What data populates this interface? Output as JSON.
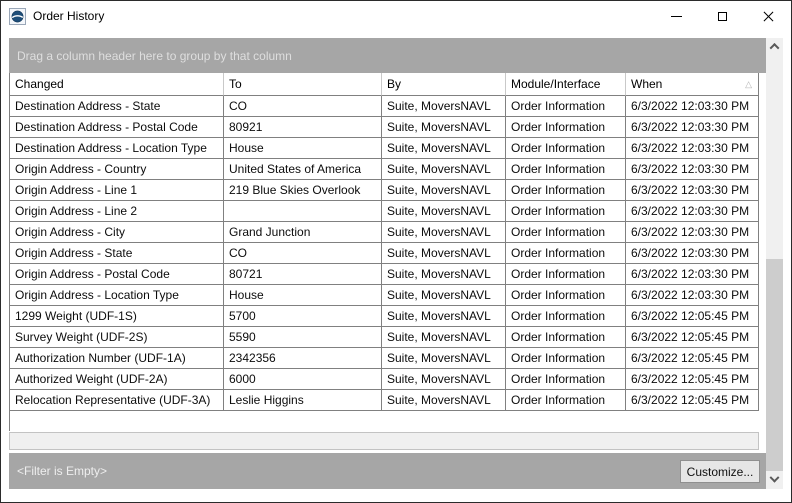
{
  "window": {
    "title": "Order History",
    "icon": "app-logo-globe",
    "controls": [
      "minimize",
      "maximize",
      "close"
    ]
  },
  "group_bar": {
    "text": "Drag a column header here to group by that column"
  },
  "table": {
    "columns": [
      {
        "key": "changed",
        "label": "Changed"
      },
      {
        "key": "to",
        "label": "To"
      },
      {
        "key": "by",
        "label": "By"
      },
      {
        "key": "module",
        "label": "Module/Interface"
      },
      {
        "key": "when",
        "label": "When"
      }
    ],
    "sort": {
      "column": "When",
      "direction": "ascending",
      "glyph": "△"
    },
    "rows": [
      {
        "changed": "Destination Address - State",
        "to": "CO",
        "by": "Suite, MoversNAVL",
        "module": "Order Information",
        "when": "6/3/2022 12:03:30 PM"
      },
      {
        "changed": "Destination Address - Postal Code",
        "to": "80921",
        "by": "Suite, MoversNAVL",
        "module": "Order Information",
        "when": "6/3/2022 12:03:30 PM"
      },
      {
        "changed": "Destination Address - Location Type",
        "to": "House",
        "by": "Suite, MoversNAVL",
        "module": "Order Information",
        "when": "6/3/2022 12:03:30 PM"
      },
      {
        "changed": "Origin Address - Country",
        "to": "United States of America",
        "by": "Suite, MoversNAVL",
        "module": "Order Information",
        "when": "6/3/2022 12:03:30 PM"
      },
      {
        "changed": "Origin Address - Line 1",
        "to": "219 Blue Skies Overlook",
        "by": "Suite, MoversNAVL",
        "module": "Order Information",
        "when": "6/3/2022 12:03:30 PM"
      },
      {
        "changed": "Origin Address - Line 2",
        "to": "",
        "by": "Suite, MoversNAVL",
        "module": "Order Information",
        "when": "6/3/2022 12:03:30 PM"
      },
      {
        "changed": "Origin Address - City",
        "to": "Grand Junction",
        "by": "Suite, MoversNAVL",
        "module": "Order Information",
        "when": "6/3/2022 12:03:30 PM"
      },
      {
        "changed": "Origin Address - State",
        "to": "CO",
        "by": "Suite, MoversNAVL",
        "module": "Order Information",
        "when": "6/3/2022 12:03:30 PM"
      },
      {
        "changed": "Origin Address - Postal Code",
        "to": "80721",
        "by": "Suite, MoversNAVL",
        "module": "Order Information",
        "when": "6/3/2022 12:03:30 PM"
      },
      {
        "changed": "Origin Address - Location Type",
        "to": "House",
        "by": "Suite, MoversNAVL",
        "module": "Order Information",
        "when": "6/3/2022 12:03:30 PM"
      },
      {
        "changed": "1299 Weight (UDF-1S)",
        "to": "5700",
        "by": "Suite, MoversNAVL",
        "module": "Order Information",
        "when": "6/3/2022 12:05:45 PM"
      },
      {
        "changed": "Survey Weight (UDF-2S)",
        "to": "5590",
        "by": "Suite, MoversNAVL",
        "module": "Order Information",
        "when": "6/3/2022 12:05:45 PM"
      },
      {
        "changed": "Authorization Number (UDF-1A)",
        "to": "2342356",
        "by": "Suite, MoversNAVL",
        "module": "Order Information",
        "when": "6/3/2022 12:05:45 PM"
      },
      {
        "changed": "Authorized Weight (UDF-2A)",
        "to": "6000",
        "by": "Suite, MoversNAVL",
        "module": "Order Information",
        "when": "6/3/2022 12:05:45 PM"
      },
      {
        "changed": "Relocation Representative (UDF-3A)",
        "to": "Leslie Higgins",
        "by": "Suite, MoversNAVL",
        "module": "Order Information",
        "when": "6/3/2022 12:05:45 PM"
      }
    ]
  },
  "footer": {
    "filter_text": "<Filter is Empty>",
    "customize_label": "Customize..."
  },
  "colors": {
    "bar_gray": "#a6a6a6",
    "grid_line": "#808080",
    "icon_blue": "#1e4e79",
    "scroll_track": "#f0f0f0",
    "scroll_thumb": "#cdcdcd"
  }
}
